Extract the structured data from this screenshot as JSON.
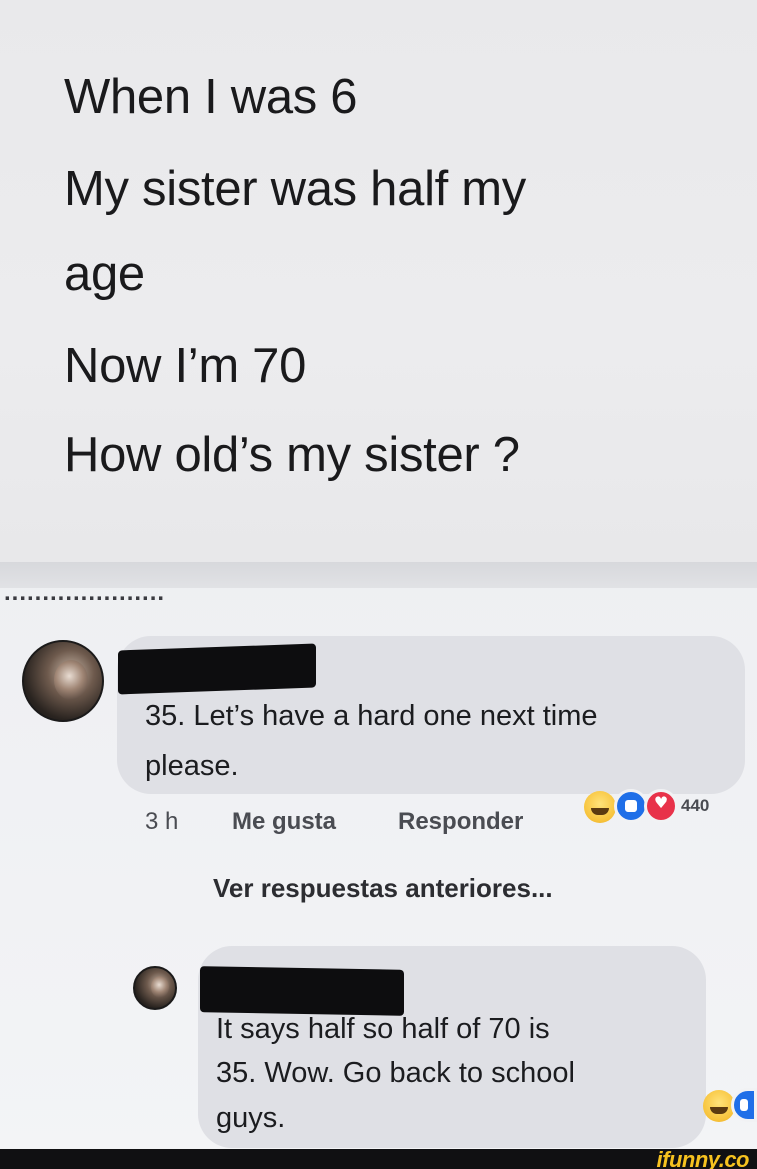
{
  "post": {
    "lines": [
      "When I was 6",
      "My sister was half my",
      "age",
      "Now I’m 70",
      "How old’s my sister ?"
    ]
  },
  "comments": [
    {
      "text_lines": [
        "35. Let’s have a hard one next time",
        "please."
      ],
      "time": "3 h",
      "like_label": "Me gusta",
      "reply_label": "Responder",
      "reaction_icons": [
        "haha-icon",
        "like-icon",
        "love-icon"
      ],
      "reaction_count": "440"
    },
    {
      "text_lines": [
        "It says half so half of 70 is",
        "35. Wow. Go back to school",
        "guys."
      ],
      "reaction_icons": [
        "haha-icon",
        "like-icon"
      ]
    }
  ],
  "view_previous_replies": "Ver respuestas anteriores...",
  "watermark": "ifunny.co",
  "colors": {
    "like_blue": "#1f6fe8",
    "love_red": "#e8324a",
    "haha_yellow": "#f7c23a",
    "watermark_yellow": "#f6c21f"
  }
}
